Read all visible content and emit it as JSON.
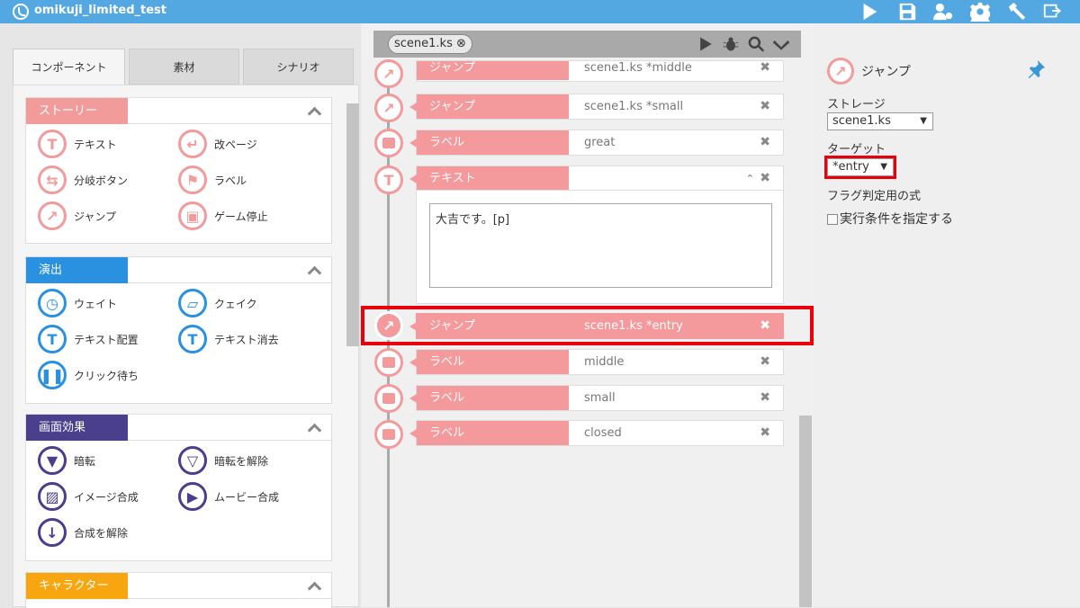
{
  "app": {
    "title": "omikuji_limited_test"
  },
  "toolbar": {
    "icons": [
      "play-icon",
      "save-icon",
      "users-gear-icon",
      "gear-icon",
      "hammer-icon",
      "export-icon"
    ]
  },
  "left": {
    "tabs": [
      "コンポーネント",
      "素材",
      "シナリオ"
    ],
    "groups": [
      {
        "title": "ストーリー",
        "color": "#f29b9b",
        "items": [
          "テキスト",
          "改ページ",
          "分岐ボタン",
          "ラベル",
          "ジャンプ",
          "ゲーム停止"
        ]
      },
      {
        "title": "演出",
        "color": "#2a90e0",
        "items": [
          "ウェイト",
          "クェイク",
          "テキスト配置",
          "テキスト消去",
          "クリック待ち"
        ]
      },
      {
        "title": "画面効果",
        "color": "#4a3f8c",
        "items": [
          "暗転",
          "暗転を解除",
          "イメージ合成",
          "ムービー合成",
          "合成を解除"
        ]
      },
      {
        "title": "キャラクター",
        "color": "#f7a60f",
        "items": []
      }
    ]
  },
  "center": {
    "file_tab": "scene1.ks",
    "rows": [
      {
        "tag": "ジャンプ",
        "value": "scene1.ks *middle"
      },
      {
        "tag": "ジャンプ",
        "value": "scene1.ks *small"
      },
      {
        "tag": "ラベル",
        "value": "great"
      },
      {
        "tag": "テキスト",
        "value": ""
      },
      {
        "tag": "ジャンプ",
        "value": "scene1.ks *entry"
      },
      {
        "tag": "ラベル",
        "value": "middle"
      },
      {
        "tag": "ラベル",
        "value": "small"
      },
      {
        "tag": "ラベル",
        "value": "closed"
      }
    ],
    "text_content": "大吉です。[p]",
    "close_glyph": "✖"
  },
  "right": {
    "title": "ジャンプ",
    "storage_label": "ストレージ",
    "storage_value": "scene1.ks",
    "target_label": "ターゲット",
    "target_value": "*entry",
    "flag_label": "フラグ判定用の式",
    "condition_label": "実行条件を指定する",
    "select_arrow": "▼"
  }
}
